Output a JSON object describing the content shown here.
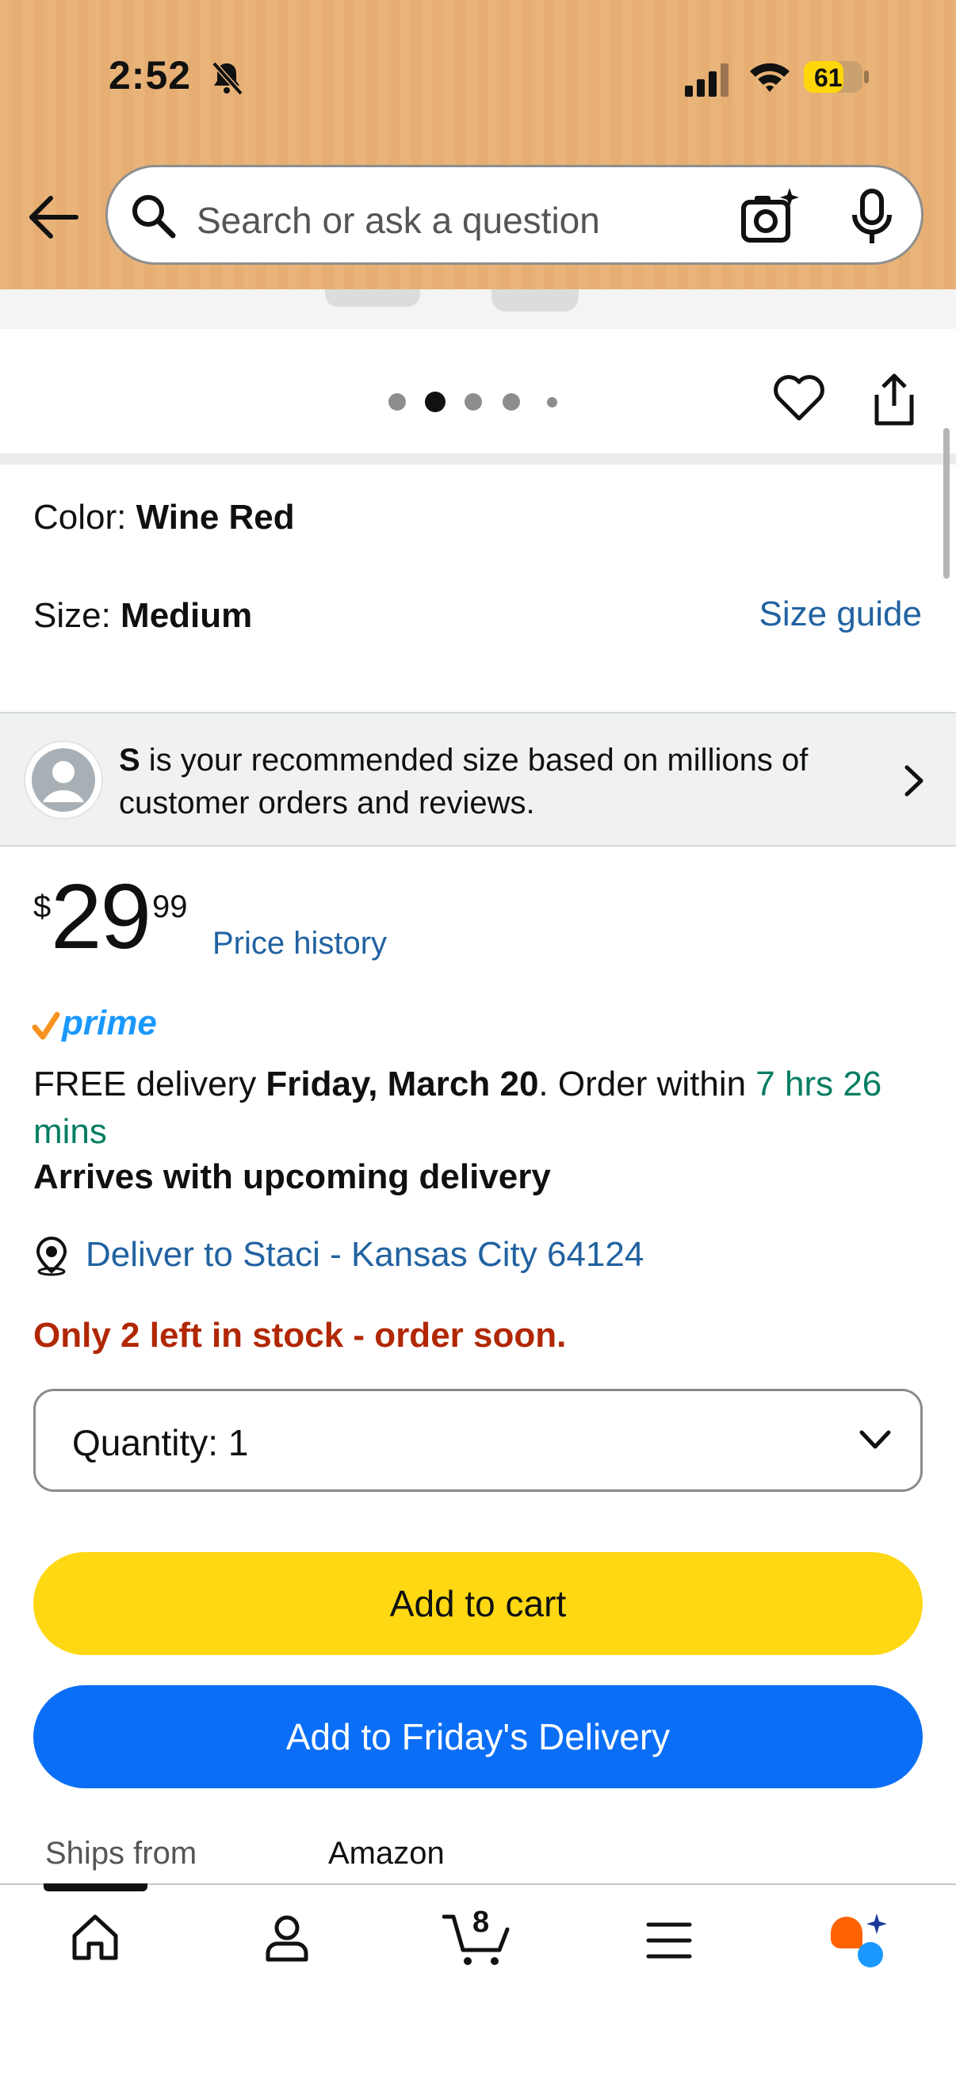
{
  "status_bar": {
    "time": "2:52",
    "battery_level": "61"
  },
  "search": {
    "placeholder": "Search or ask a question"
  },
  "gallery": {
    "dot_count": 5,
    "active_dot": 1
  },
  "variations": {
    "color_label": "Color: ",
    "color_value": "Wine Red",
    "size_label": "Size: ",
    "size_value": "Medium",
    "size_guide": "Size guide"
  },
  "recommendation": {
    "size": "S",
    "text": " is your recommended size based on millions of customer orders and reviews."
  },
  "price": {
    "symbol": "$",
    "whole": "29",
    "fraction": "99",
    "history_link": "Price history"
  },
  "delivery": {
    "prime_label": "prime",
    "prefix": "FREE delivery ",
    "date": "Friday, March 20",
    "middle": ". Order within ",
    "countdown": "7 hrs 26 mins",
    "arrives": "Arrives with upcoming delivery",
    "deliver_to": "Deliver to Staci - Kansas City 64124"
  },
  "stock": {
    "message": "Only 2 left in stock - order soon."
  },
  "quantity": {
    "label": "Quantity: 1"
  },
  "buttons": {
    "add_to_cart": "Add to cart",
    "add_to_delivery": "Add to Friday's Delivery"
  },
  "ships_from": {
    "label": "Ships from",
    "value": "Amazon"
  },
  "bottom_nav": {
    "cart_count": "8",
    "items": [
      "home",
      "account",
      "cart",
      "menu",
      "rufus"
    ]
  },
  "colors": {
    "header_bg": "#e9b47a",
    "link": "#2162a1",
    "countdown_green": "#067d62",
    "stock_red": "#b12704",
    "cart_yellow": "#ffd814",
    "delivery_blue": "#0a6ef7",
    "prime_blue": "#1a98ff",
    "prime_check": "#f7931e"
  }
}
